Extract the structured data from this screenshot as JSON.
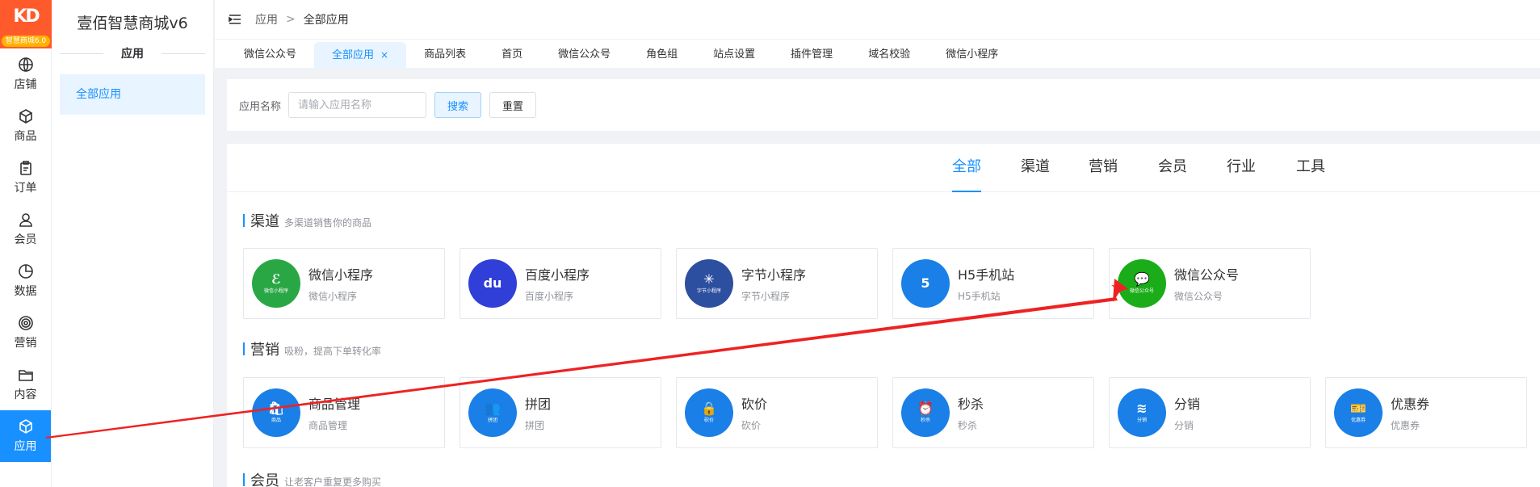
{
  "logo": {
    "badge": "智慧商城6.0"
  },
  "rail": [
    {
      "label": "店铺",
      "icon": "globe-icon"
    },
    {
      "label": "商品",
      "icon": "cube-icon"
    },
    {
      "label": "订单",
      "icon": "clipboard-icon"
    },
    {
      "label": "会员",
      "icon": "user-icon"
    },
    {
      "label": "数据",
      "icon": "pie-chart-icon"
    },
    {
      "label": "营销",
      "icon": "target-icon"
    },
    {
      "label": "内容",
      "icon": "folder-icon"
    },
    {
      "label": "应用",
      "icon": "cube-icon",
      "active": true
    }
  ],
  "sidebar": {
    "title": "壹佰智慧商城v6",
    "section": "应用",
    "items": [
      {
        "label": "全部应用"
      }
    ]
  },
  "breadcrumb": {
    "root": "应用",
    "sep": ">",
    "current": "全部应用"
  },
  "tabs": [
    {
      "label": "微信公众号"
    },
    {
      "label": "全部应用",
      "active": true,
      "close": "×"
    },
    {
      "label": "商品列表"
    },
    {
      "label": "首页"
    },
    {
      "label": "微信公众号"
    },
    {
      "label": "角色组"
    },
    {
      "label": "站点设置"
    },
    {
      "label": "插件管理"
    },
    {
      "label": "域名校验"
    },
    {
      "label": "微信小程序"
    }
  ],
  "search": {
    "label": "应用名称",
    "placeholder": "请输入应用名称",
    "value": "",
    "search_btn": "搜索",
    "reset_btn": "重置"
  },
  "categories": [
    {
      "label": "全部",
      "active": true
    },
    {
      "label": "渠道"
    },
    {
      "label": "营销"
    },
    {
      "label": "会员"
    },
    {
      "label": "行业"
    },
    {
      "label": "工具"
    }
  ],
  "sections": [
    {
      "title": "渠道",
      "desc": "多渠道销售你的商品",
      "apps": [
        {
          "name": "微信小程序",
          "sub": "微信小程序",
          "color": "#2aa745",
          "glyph": "ℰ",
          "tiny": "微信小程序",
          "icon": "wechat-miniprogram-icon"
        },
        {
          "name": "百度小程序",
          "sub": "百度小程序",
          "color": "#2f3fd8",
          "glyph": "du",
          "tiny": "",
          "icon": "baidu-paw-icon"
        },
        {
          "name": "字节小程序",
          "sub": "字节小程序",
          "color": "#2d4fa0",
          "glyph": "✳",
          "tiny": "字节小程序",
          "icon": "bytedance-icon"
        },
        {
          "name": "H5手机站",
          "sub": "H5手机站",
          "color": "#1a7fe6",
          "glyph": "5",
          "tiny": "",
          "icon": "html5-icon"
        },
        {
          "name": "微信公众号",
          "sub": "微信公众号",
          "color": "#1aad19",
          "glyph": "💬",
          "tiny": "微信公众号",
          "icon": "wechat-official-icon"
        }
      ]
    },
    {
      "title": "营销",
      "desc": "吸粉，提高下单转化率",
      "apps": [
        {
          "name": "商品管理",
          "sub": "商品管理",
          "color": "#1a7fe6",
          "glyph": "🛍",
          "tiny": "商品",
          "icon": "goods-icon"
        },
        {
          "name": "拼团",
          "sub": "拼团",
          "color": "#1a7fe6",
          "glyph": "👥",
          "tiny": "拼团",
          "icon": "group-buy-icon"
        },
        {
          "name": "砍价",
          "sub": "砍价",
          "color": "#1a7fe6",
          "glyph": "🔒",
          "tiny": "砍价",
          "icon": "bargain-icon"
        },
        {
          "name": "秒杀",
          "sub": "秒杀",
          "color": "#1a7fe6",
          "glyph": "⏰",
          "tiny": "秒杀",
          "icon": "flash-sale-icon"
        },
        {
          "name": "分销",
          "sub": "分销",
          "color": "#1a7fe6",
          "glyph": "≋",
          "tiny": "分销",
          "icon": "distribution-icon"
        },
        {
          "name": "优惠券",
          "sub": "优惠券",
          "color": "#1a7fe6",
          "glyph": "🎫",
          "tiny": "优惠券",
          "icon": "coupon-icon"
        }
      ]
    },
    {
      "title": "会员",
      "desc": "让老客户重复更多购买",
      "apps": []
    }
  ],
  "colors": {
    "accent": "#1890ff",
    "annotation": "#ee2222"
  }
}
